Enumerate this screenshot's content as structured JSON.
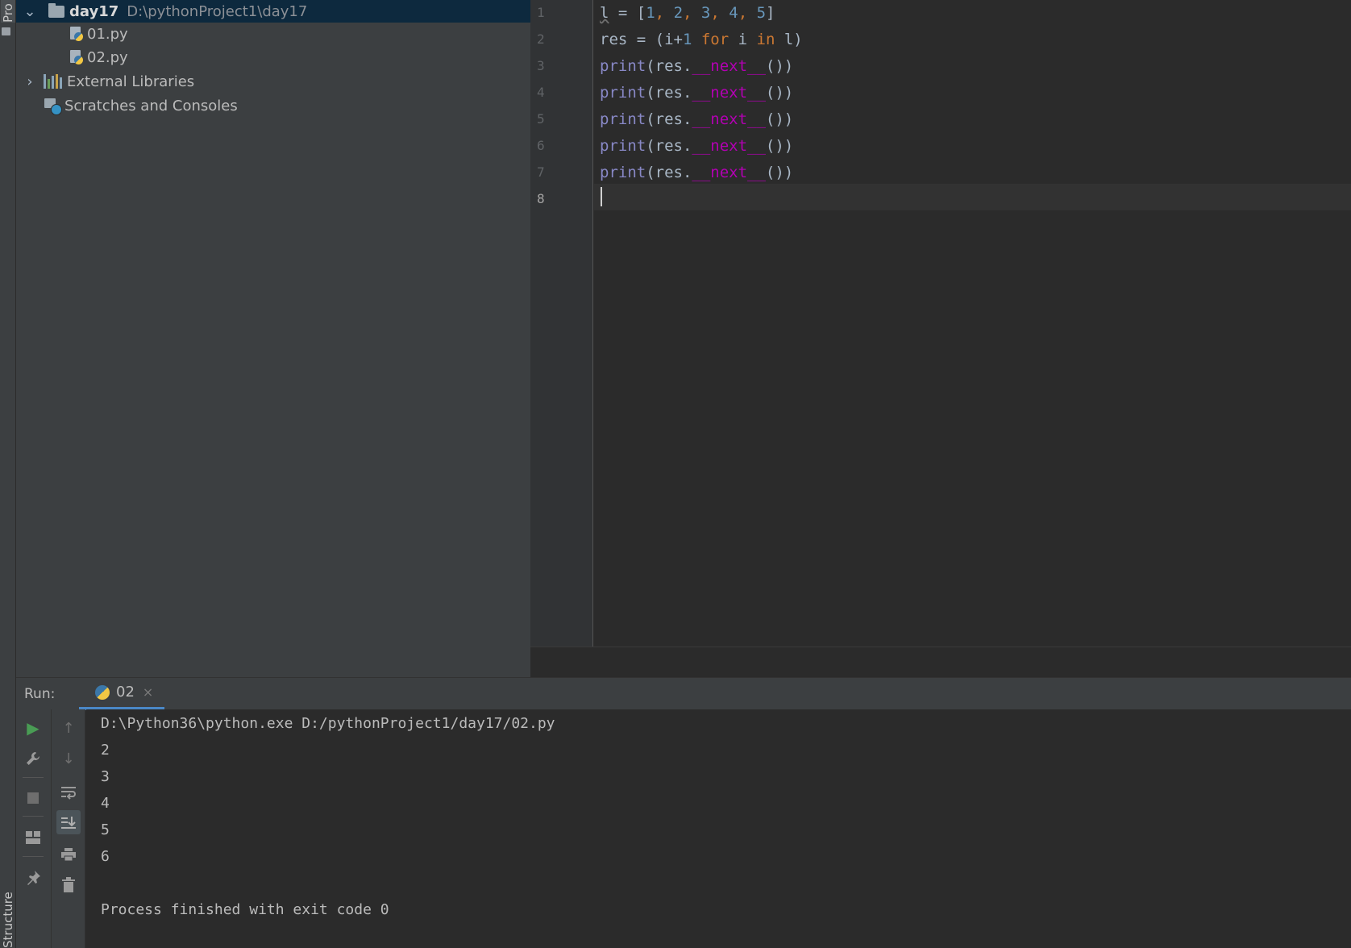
{
  "tool_strip": {
    "project_tab": "Pro",
    "structure_tab": "Structure"
  },
  "project_tree": {
    "root_name": "day17",
    "root_path": "D:\\pythonProject1\\day17",
    "files": [
      "01.py",
      "02.py"
    ],
    "external_libraries": "External Libraries",
    "scratches": "Scratches and Consoles"
  },
  "editor": {
    "line_numbers": [
      "1",
      "2",
      "3",
      "4",
      "5",
      "6",
      "7",
      "8"
    ],
    "code": {
      "line1": {
        "var": "l",
        "eq": " = [",
        "n1": "1",
        "c1": ", ",
        "n2": "2",
        "c2": ", ",
        "n3": "3",
        "c3": ", ",
        "n4": "4",
        "c4": ", ",
        "n5": "5",
        "end": "]"
      },
      "line2": {
        "a": "res = (i+",
        "one": "1",
        "sp": " ",
        "for": "for",
        "mid": " i ",
        "in": "in",
        "end": " l)"
      },
      "print_call": {
        "fn": "print",
        "open": "(res.",
        "method": "__next__",
        "close": "())"
      }
    }
  },
  "run_panel": {
    "label": "Run:",
    "tab_label": "02",
    "tab_close": "×",
    "output": [
      "D:\\Python36\\python.exe D:/pythonProject1/day17/02.py",
      "2",
      "3",
      "4",
      "5",
      "6",
      "",
      "Process finished with exit code 0"
    ]
  },
  "colors": {
    "keyword": "#cc7832",
    "number": "#6897bb",
    "builtin": "#8888c6",
    "dunder": "#b200b2",
    "selection": "#0d293e",
    "run_green": "#499c54"
  }
}
